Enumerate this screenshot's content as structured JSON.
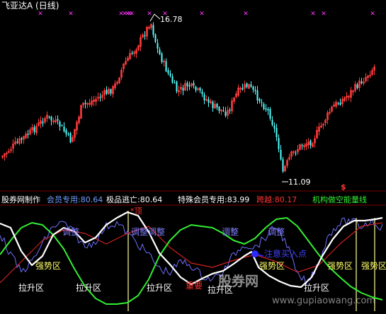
{
  "header": {
    "title": "飞亚达A (日线)"
  },
  "colors": {
    "background": "#000000",
    "up": "#ff3b3b",
    "down": "#54ffff",
    "marker": "#ff33ff",
    "white_line": "#ffffff",
    "green_line": "#33ee33",
    "red_line": "#d02020",
    "blue_line": "#6f6fff",
    "yellow": "#ffff66",
    "ref_yellow": "#ffff99"
  },
  "top_annotations": {
    "high_label": "16.78",
    "low_label": "11.09",
    "dollar_marker": "$"
  },
  "info_bar": {
    "prefix": "股券网制作",
    "member": "会员专用:80.64",
    "extreme": "极品逃亡:80.64",
    "special": "特殊会员专用:83.99",
    "cross": "跨越:80.17",
    "inst": "机构做空能量线"
  },
  "indicator_labels": {
    "top_marker": "*顶",
    "adjust_1": "调整",
    "adjust_2": "调整调整",
    "adjust_3": "调整",
    "adjust_4": "调整",
    "strong_1": "强势区",
    "strong_2": "强势区",
    "strong_3": "强势区",
    "strong_4": "强势区",
    "pull_1": "拉升区",
    "pull_2": "拉升区",
    "pull_3": "拉升区",
    "pull_4": "拉升区",
    "pull_5": "拉升区",
    "bottom_red": "重要",
    "attention": "注意买入点",
    "watermark": "股券网",
    "watermark_url": "www.gupiaowang.com"
  },
  "chart_data": [
    {
      "type": "candlestick",
      "title": "飞亚达A (日线)",
      "annotations": {
        "high": 16.78,
        "low": 11.09
      },
      "approx_price_range": [
        11.09,
        16.78
      ],
      "top_markers": "magenta ✕ markers along top edge"
    },
    {
      "type": "line",
      "title": "股券网制作",
      "series": [
        {
          "name": "会员专用",
          "last_value": 80.64
        },
        {
          "name": "极品逃亡",
          "last_value": 80.64
        },
        {
          "name": "特殊会员专用",
          "last_value": 83.99
        },
        {
          "name": "跨越",
          "last_value": 80.17
        },
        {
          "name": "机构做空能量线"
        }
      ],
      "zones": [
        "调整",
        "强势区",
        "拉升区"
      ]
    }
  ]
}
